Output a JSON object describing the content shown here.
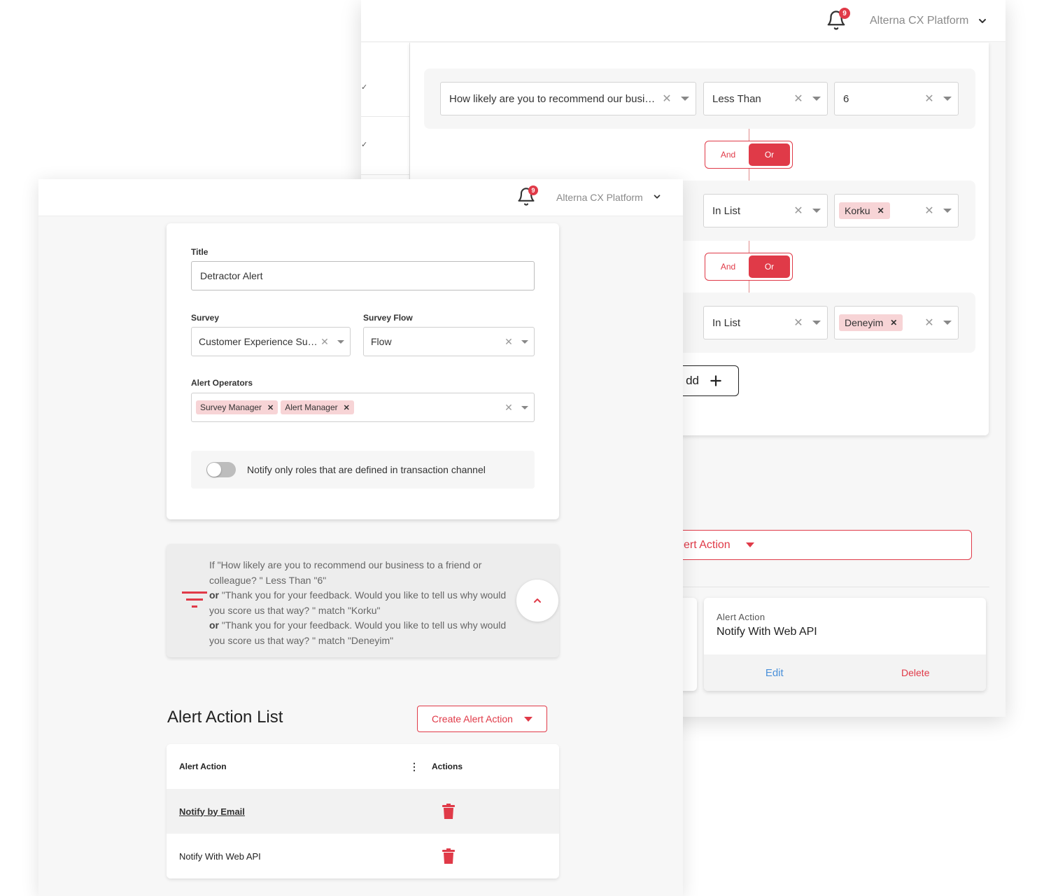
{
  "header": {
    "platform_name": "Alterna CX Platform",
    "notification_count": "9"
  },
  "conditions_panel": {
    "rows": [
      {
        "question": "How likely are you to recommend our business to a friend or colleague?",
        "operator": "Less Than",
        "value": "6"
      },
      {
        "operator": "In List",
        "chip": "Korku"
      },
      {
        "operator": "In List",
        "chip": "Deneyim"
      }
    ],
    "logic": {
      "and_label": "And",
      "or_label": "Or",
      "and_label_partial": "d",
      "selected": "Or"
    },
    "add_label": "dd",
    "alert_action_dropdown_label": "ert Action",
    "alert_action_card": {
      "label": "Alert Action",
      "value": "Notify With Web API",
      "edit": "Edit",
      "delete": "Delete"
    }
  },
  "form": {
    "title_label": "Title",
    "title_value": "Detractor Alert",
    "survey_label": "Survey",
    "survey_value": "Customer Experience Survey",
    "flow_label": "Survey Flow",
    "flow_value": "Flow",
    "operators_label": "Alert Operators",
    "operators": [
      "Survey Manager",
      "Alert Manager"
    ],
    "notify_toggle_label": "Notify only roles that are defined in transaction channel",
    "notify_toggle_on": false
  },
  "summary": {
    "line1": "If \"How likely are you to recommend our business to a friend or colleague? \" Less Than \"6\"",
    "or_word": "or",
    "line2": " \"Thank you for your feedback. Would you like to tell us why would you score us that way? \" match \"Korku\"",
    "line3": " \"Thank you for your feedback. Would you like to tell us why would you score us that way? \" match \"Deneyim\""
  },
  "alert_action_list": {
    "title": "Alert Action List",
    "create_button": "Create Alert Action",
    "columns": [
      "Alert Action",
      "Actions"
    ],
    "rows": [
      {
        "name": "Notify by Email",
        "is_link": true
      },
      {
        "name": "Notify With Web API",
        "is_link": false
      }
    ]
  },
  "colors": {
    "accent": "#e03a48",
    "chip_bg": "#f7d4d6",
    "link_blue": "#4a90d9"
  }
}
